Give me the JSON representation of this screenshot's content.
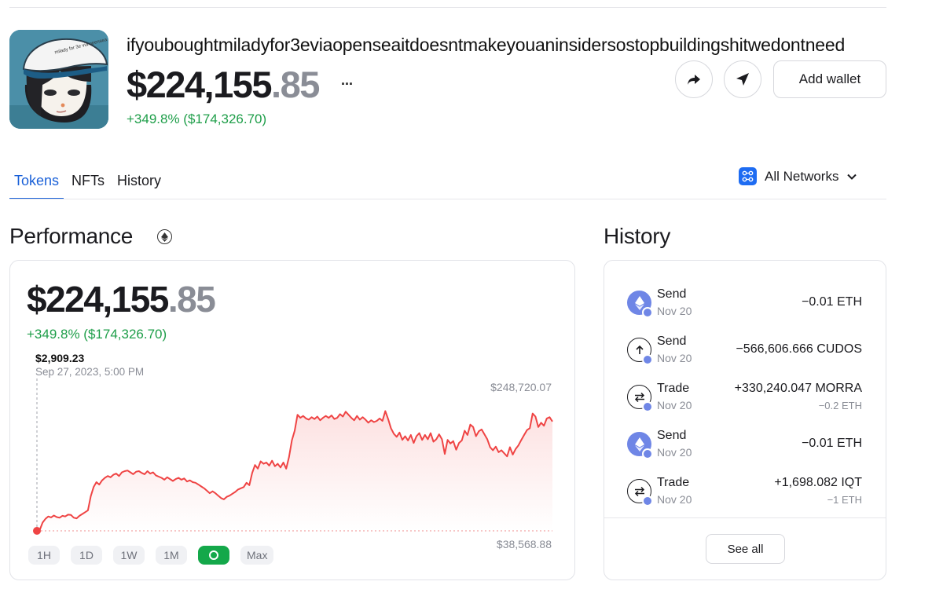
{
  "profile": {
    "wallet_name": "ifyouboughtmiladyfor3eviaopenseaitdoesntmakeyouaninsidersostopbuildingshitwedontneed",
    "balance_whole": "$224,155",
    "balance_cents": ".85",
    "balance_change": "+349.8% ($174,326.70)",
    "more_label": "...",
    "avatar_hat_text": "milady for 3e via opensea"
  },
  "actions": {
    "share_icon": "share-arrow-icon",
    "send_icon": "navigation-arrow-icon",
    "add_wallet_label": "Add wallet"
  },
  "tabs": [
    {
      "label": "Tokens",
      "active": true
    },
    {
      "label": "NFTs",
      "active": false
    },
    {
      "label": "History",
      "active": false
    }
  ],
  "network": {
    "label": "All Networks",
    "icon": "network-grid-icon",
    "accent": "#1e6cf2"
  },
  "performance": {
    "title": "Performance",
    "balance_whole": "$224,155",
    "balance_cents": ".85",
    "change": "+349.8% ($174,326.70)",
    "tooltip_value": "$2,909.23",
    "tooltip_date": "Sep 27, 2023, 5:00 PM",
    "max_label": "$248,720.07",
    "min_label": "$38,568.88",
    "ranges": [
      "1H",
      "1D",
      "1W",
      "1M",
      "",
      "Max"
    ],
    "active_range_index": 4,
    "colors": {
      "up": "#1e9e49",
      "line": "#ef4444",
      "active_range": "#14a84a"
    }
  },
  "chart_data": {
    "type": "line",
    "title": "",
    "xlabel": "",
    "ylabel": "",
    "ylim": [
      38568.88,
      248720.07
    ],
    "series": [
      {
        "values": [
          2909.23,
          40000,
          52000,
          58000,
          62000,
          60500,
          63500,
          61000,
          60000,
          63000,
          62000,
          65000,
          64500,
          60000,
          59000,
          63000,
          66000,
          69000,
          72000,
          95000,
          110000,
          118000,
          114000,
          121000,
          125000,
          128000,
          126000,
          130000,
          132000,
          128000,
          134000,
          136000,
          137000,
          134000,
          131000,
          135000,
          136000,
          133000,
          131000,
          136000,
          132000,
          134000,
          129000,
          127000,
          125000,
          122000,
          126000,
          123000,
          120000,
          123000,
          125000,
          122000,
          124000,
          119000,
          121000,
          118000,
          117000,
          114000,
          111000,
          108000,
          104000,
          100000,
          103000,
          100000,
          96000,
          92000,
          90000,
          94000,
          96000,
          99000,
          102000,
          106000,
          108000,
          110000,
          117000,
          113000,
          133000,
          146000,
          140000,
          152000,
          148000,
          150000,
          145000,
          153000,
          144000,
          148000,
          142000,
          150000,
          140000,
          159000,
          186000,
          202000,
          228000,
          223000,
          226000,
          222000,
          220000,
          224000,
          221000,
          225000,
          219000,
          223000,
          226000,
          223000,
          227000,
          221000,
          223000,
          229000,
          225000,
          233000,
          228000,
          223000,
          219000,
          226000,
          220000,
          224000,
          220000,
          215000,
          219000,
          216000,
          218000,
          222000,
          218000,
          234000,
          221000,
          206000,
          197000,
          192000,
          199000,
          187000,
          193000,
          186000,
          195000,
          182000,
          193000,
          198000,
          187000,
          195000,
          188000,
          198000,
          184000,
          188000,
          196000,
          188000,
          164000,
          187000,
          181000,
          185000,
          171000,
          182000,
          186000,
          202000,
          195000,
          212000,
          208000,
          193000,
          201000,
          204000,
          196000,
          188000,
          175000,
          170000,
          176000,
          167000,
          170000,
          165000,
          160000,
          175000,
          163000,
          172000,
          178000,
          187000,
          195000,
          203000,
          206000,
          230000,
          225000,
          208000,
          215000,
          210000,
          222000,
          224000,
          217000
        ]
      }
    ]
  },
  "history": {
    "title": "History",
    "see_all_label": "See all",
    "badge_color": "#6f86e6",
    "items": [
      {
        "type": "Send",
        "date": "Nov 20",
        "amount": "−0.01 ETH",
        "sub": "",
        "icon": "ethereum-icon"
      },
      {
        "type": "Send",
        "date": "Nov 20",
        "amount": "−566,606.666 CUDOS",
        "sub": "",
        "icon": "send-arrow-icon"
      },
      {
        "type": "Trade",
        "date": "Nov 20",
        "amount": "+330,240.047 MORRA",
        "sub": "−0.2 ETH",
        "icon": "trade-arrows-icon"
      },
      {
        "type": "Send",
        "date": "Nov 20",
        "amount": "−0.01 ETH",
        "sub": "",
        "icon": "ethereum-icon"
      },
      {
        "type": "Trade",
        "date": "Nov 20",
        "amount": "+1,698.082 IQT",
        "sub": "−1 ETH",
        "icon": "trade-arrows-icon"
      }
    ]
  }
}
